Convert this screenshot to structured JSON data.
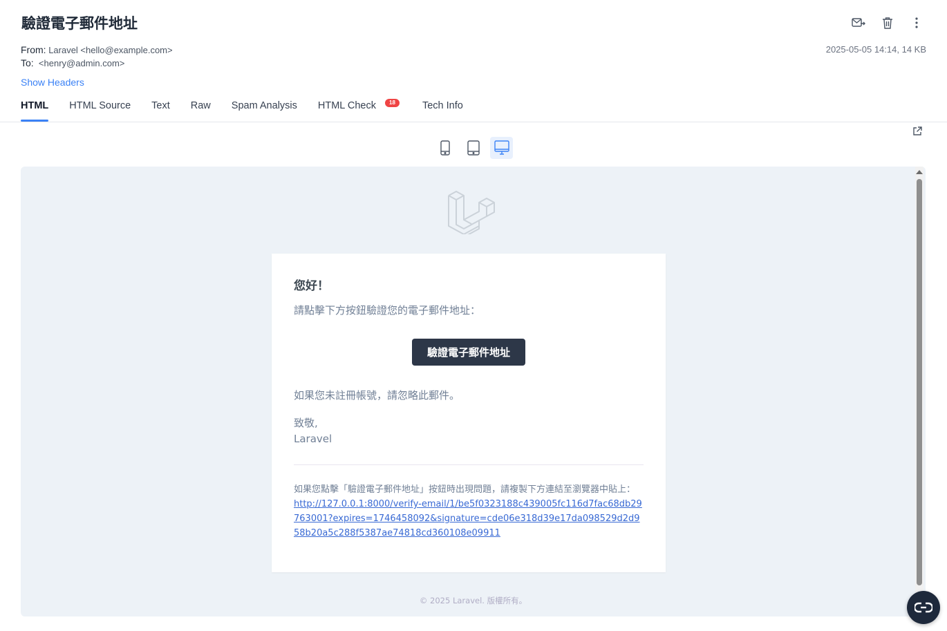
{
  "email": {
    "subject": "驗證電子郵件地址",
    "from_label": "From:",
    "from_value": "Laravel <hello@example.com>",
    "to_label": "To:",
    "to_value": "<henry@admin.com>",
    "date_size": "2025-05-05 14:14, 14 KB",
    "show_headers": "Show Headers"
  },
  "tabs": [
    {
      "label": "HTML",
      "active": true
    },
    {
      "label": "HTML Source"
    },
    {
      "label": "Text"
    },
    {
      "label": "Raw"
    },
    {
      "label": "Spam Analysis"
    },
    {
      "label": "HTML Check",
      "badge": "18"
    },
    {
      "label": "Tech Info"
    }
  ],
  "actions": [
    "forward-icon",
    "trash-icon",
    "more-vertical-icon"
  ],
  "devices": [
    "phone-icon",
    "tablet-icon",
    "desktop-icon"
  ],
  "preview": {
    "greeting": "您好！",
    "intro": "請點擊下方按鈕驗證您的電子郵件地址：",
    "button": "驗證電子郵件地址",
    "outro": "如果您未註冊帳號，請忽略此郵件。",
    "regards": "致敬,",
    "sender": "Laravel",
    "subcopy_text": "如果您點擊「驗證電子郵件地址」按鈕時出現問題，請複製下方連結至瀏覽器中貼上：",
    "subcopy_link": "http://127.0.0.1:8000/verify-email/1/be5f0323188c439005fc116d7fac68db29763001?expires=1746458092&signature=cde06e318d39e17da098529d2d958b20a5c288f5387ae74818cd360108e09911",
    "footer": "© 2025 Laravel. 版權所有。"
  },
  "colors": {
    "accent": "#3b82f6",
    "badge": "#ef4444",
    "button_bg": "#2d3748",
    "preview_bg": "#edf2f7"
  }
}
